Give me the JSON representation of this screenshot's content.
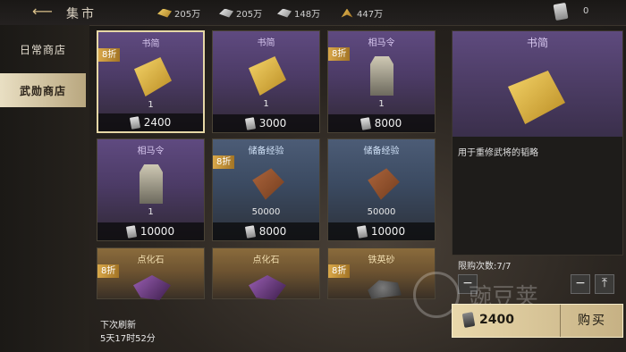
{
  "header": {
    "title": "集市",
    "resources": [
      {
        "icon": "gold-ingot-icon",
        "value": "205万"
      },
      {
        "icon": "silver-ingot-icon",
        "value": "205万"
      },
      {
        "icon": "iron-icon",
        "value": "148万"
      },
      {
        "icon": "grain-icon",
        "value": "447万"
      }
    ],
    "token_value": "0"
  },
  "sidebar": {
    "tabs": [
      {
        "label": "日常商店",
        "active": false
      },
      {
        "label": "武勋商店",
        "active": true
      }
    ]
  },
  "items": [
    {
      "name": "书简",
      "discount": "8折",
      "qty": "1",
      "price": "2400",
      "icon": "scroll-icon",
      "style": "purple",
      "selected": true
    },
    {
      "name": "书简",
      "discount": "",
      "qty": "1",
      "price": "3000",
      "icon": "scroll-icon",
      "style": "purple"
    },
    {
      "name": "相马令",
      "discount": "8折",
      "qty": "1",
      "price": "8000",
      "icon": "token-icon",
      "style": "purple"
    },
    {
      "name": "相马令",
      "discount": "",
      "qty": "1",
      "price": "10000",
      "icon": "token-icon",
      "style": "purple"
    },
    {
      "name": "储备经验",
      "discount": "8折",
      "qty": "50000",
      "price": "8000",
      "icon": "book-icon",
      "style": "blue"
    },
    {
      "name": "储备经验",
      "discount": "",
      "qty": "50000",
      "price": "10000",
      "icon": "book-icon",
      "style": "blue"
    },
    {
      "name": "点化石",
      "discount": "8折",
      "qty": "",
      "price": "",
      "icon": "gem-icon",
      "style": "gold"
    },
    {
      "name": "点化石",
      "discount": "",
      "qty": "",
      "price": "",
      "icon": "gem-icon",
      "style": "gold"
    },
    {
      "name": "铁英砂",
      "discount": "8折",
      "qty": "",
      "price": "",
      "icon": "ore-icon",
      "style": "gold"
    }
  ],
  "detail": {
    "name": "书简",
    "description": "用于重修武将的韬略",
    "limit": "限购次数:7/7",
    "price": "2400",
    "buy_label": "购买"
  },
  "refresh": {
    "label": "下次刷新",
    "time": "5天17时52分"
  },
  "watermark": "豌豆荚"
}
